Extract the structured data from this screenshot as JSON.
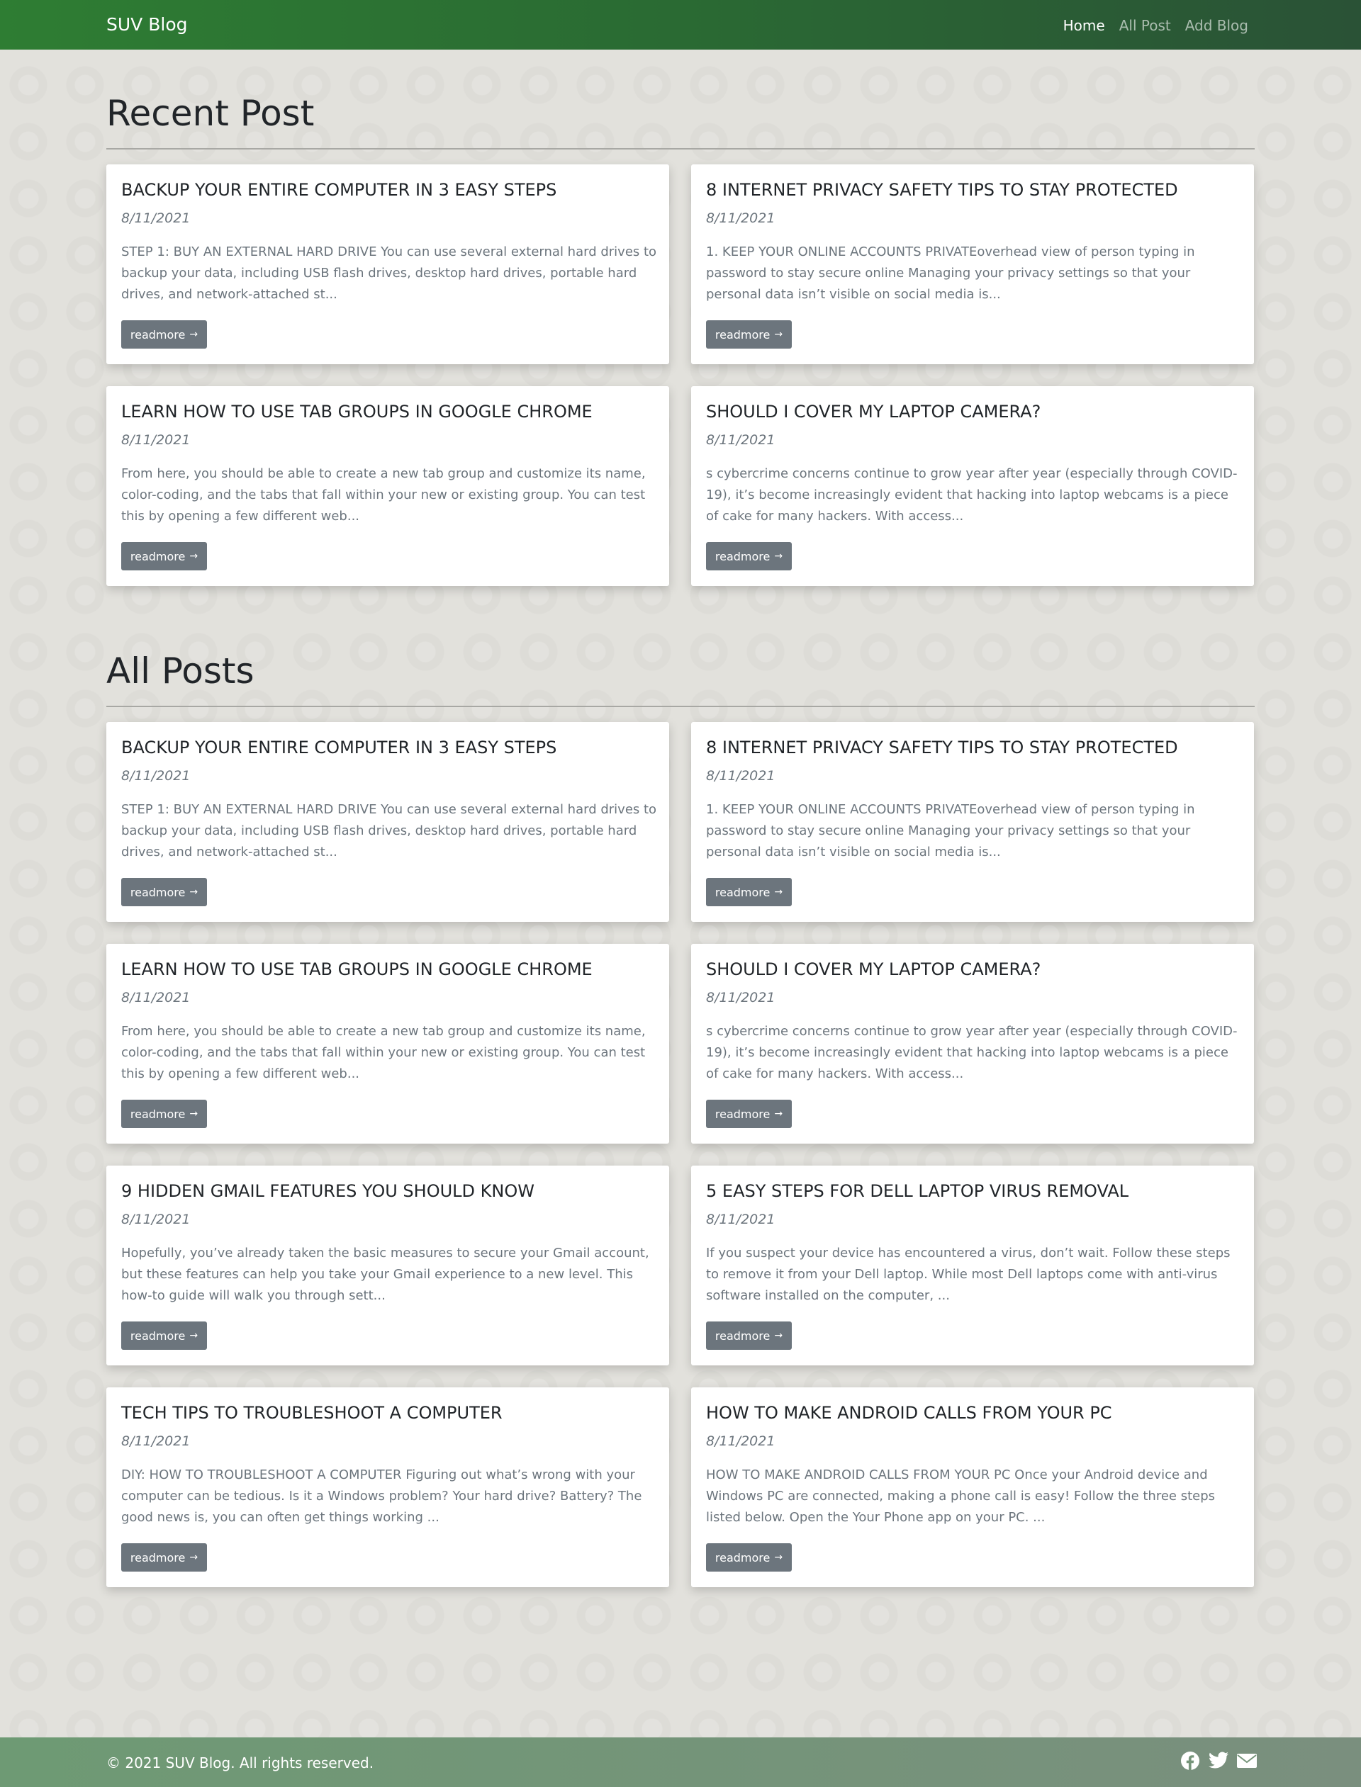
{
  "navbar": {
    "brand": "SUV Blog",
    "links": [
      {
        "label": "Home",
        "active": true
      },
      {
        "label": "All Post",
        "active": false
      },
      {
        "label": "Add Blog",
        "active": false
      }
    ]
  },
  "recent": {
    "title": "Recent Post",
    "posts": [
      {
        "title": "BACKUP YOUR ENTIRE COMPUTER IN 3 EASY STEPS",
        "date": "8/11/2021",
        "excerpt": "STEP 1: BUY AN EXTERNAL HARD DRIVE You can use several external hard drives to backup your data, including USB flash drives, desktop hard drives, portable hard drives, and network-attached st...",
        "button": "readmore"
      },
      {
        "title": "8 INTERNET PRIVACY SAFETY TIPS TO STAY PROTECTED",
        "date": "8/11/2021",
        "excerpt": "1. KEEP YOUR ONLINE ACCOUNTS PRIVATEoverhead view of person typing in password to stay secure online Managing your privacy settings so that your personal data isn’t visible on social media is...",
        "button": "readmore"
      },
      {
        "title": "LEARN HOW TO USE TAB GROUPS IN GOOGLE CHROME",
        "date": "8/11/2021",
        "excerpt": "From here, you should be able to create a new tab group and customize its name, color-coding, and the tabs that fall within your new or existing group. You can test this by opening a few different web...",
        "button": "readmore"
      },
      {
        "title": "SHOULD I COVER MY LAPTOP CAMERA?",
        "date": "8/11/2021",
        "excerpt": "s cybercrime concerns continue to grow year after year (especially through COVID-19), it’s become increasingly evident that hacking into laptop webcams is a piece of cake for many hackers. With access...",
        "button": "readmore"
      }
    ]
  },
  "all": {
    "title": "All Posts",
    "posts": [
      {
        "title": "BACKUP YOUR ENTIRE COMPUTER IN 3 EASY STEPS",
        "date": "8/11/2021",
        "excerpt": "STEP 1: BUY AN EXTERNAL HARD DRIVE You can use several external hard drives to backup your data, including USB flash drives, desktop hard drives, portable hard drives, and network-attached st...",
        "button": "readmore"
      },
      {
        "title": "8 INTERNET PRIVACY SAFETY TIPS TO STAY PROTECTED",
        "date": "8/11/2021",
        "excerpt": "1. KEEP YOUR ONLINE ACCOUNTS PRIVATEoverhead view of person typing in password to stay secure online Managing your privacy settings so that your personal data isn’t visible on social media is...",
        "button": "readmore"
      },
      {
        "title": "LEARN HOW TO USE TAB GROUPS IN GOOGLE CHROME",
        "date": "8/11/2021",
        "excerpt": "From here, you should be able to create a new tab group and customize its name, color-coding, and the tabs that fall within your new or existing group. You can test this by opening a few different web...",
        "button": "readmore"
      },
      {
        "title": "SHOULD I COVER MY LAPTOP CAMERA?",
        "date": "8/11/2021",
        "excerpt": "s cybercrime concerns continue to grow year after year (especially through COVID-19), it’s become increasingly evident that hacking into laptop webcams is a piece of cake for many hackers. With access...",
        "button": "readmore"
      },
      {
        "title": "9 HIDDEN GMAIL FEATURES YOU SHOULD KNOW",
        "date": "8/11/2021",
        "excerpt": "Hopefully, you’ve already taken the basic measures to secure your Gmail account, but these features can help you take your Gmail experience to a new level. This how-to guide will walk you through sett...",
        "button": "readmore"
      },
      {
        "title": "5 EASY STEPS FOR DELL LAPTOP VIRUS REMOVAL",
        "date": "8/11/2021",
        "excerpt": "If you suspect your device has encountered a virus, don’t wait. Follow these steps to remove it from your Dell laptop. While most Dell laptops come with anti-virus software installed on the computer, ...",
        "button": "readmore"
      },
      {
        "title": "TECH TIPS TO TROUBLESHOOT A COMPUTER",
        "date": "8/11/2021",
        "excerpt": "DIY: HOW TO TROUBLESHOOT A COMPUTER Figuring out what’s wrong with your computer can be tedious. Is it a Windows problem? Your hard drive? Battery? The good news is, you can often get things working ...",
        "button": "readmore"
      },
      {
        "title": "HOW TO MAKE ANDROID CALLS FROM YOUR PC",
        "date": "8/11/2021",
        "excerpt": "HOW TO MAKE ANDROID CALLS FROM YOUR PC Once your Android device and Windows PC are connected, making a phone call is easy! Follow the three steps listed below. Open the Your Phone app on your PC. ...",
        "button": "readmore"
      }
    ]
  },
  "footer": {
    "copyright": "© 2021 SUV Blog. All rights reserved.",
    "socials": [
      "facebook-icon",
      "twitter-icon",
      "mail-icon"
    ]
  },
  "colors": {
    "navbar_start": "#2e7d33",
    "navbar_end": "#2a5236",
    "button": "#6c757d",
    "footer": "#76957a",
    "page_bg": "#e2e1dc"
  }
}
